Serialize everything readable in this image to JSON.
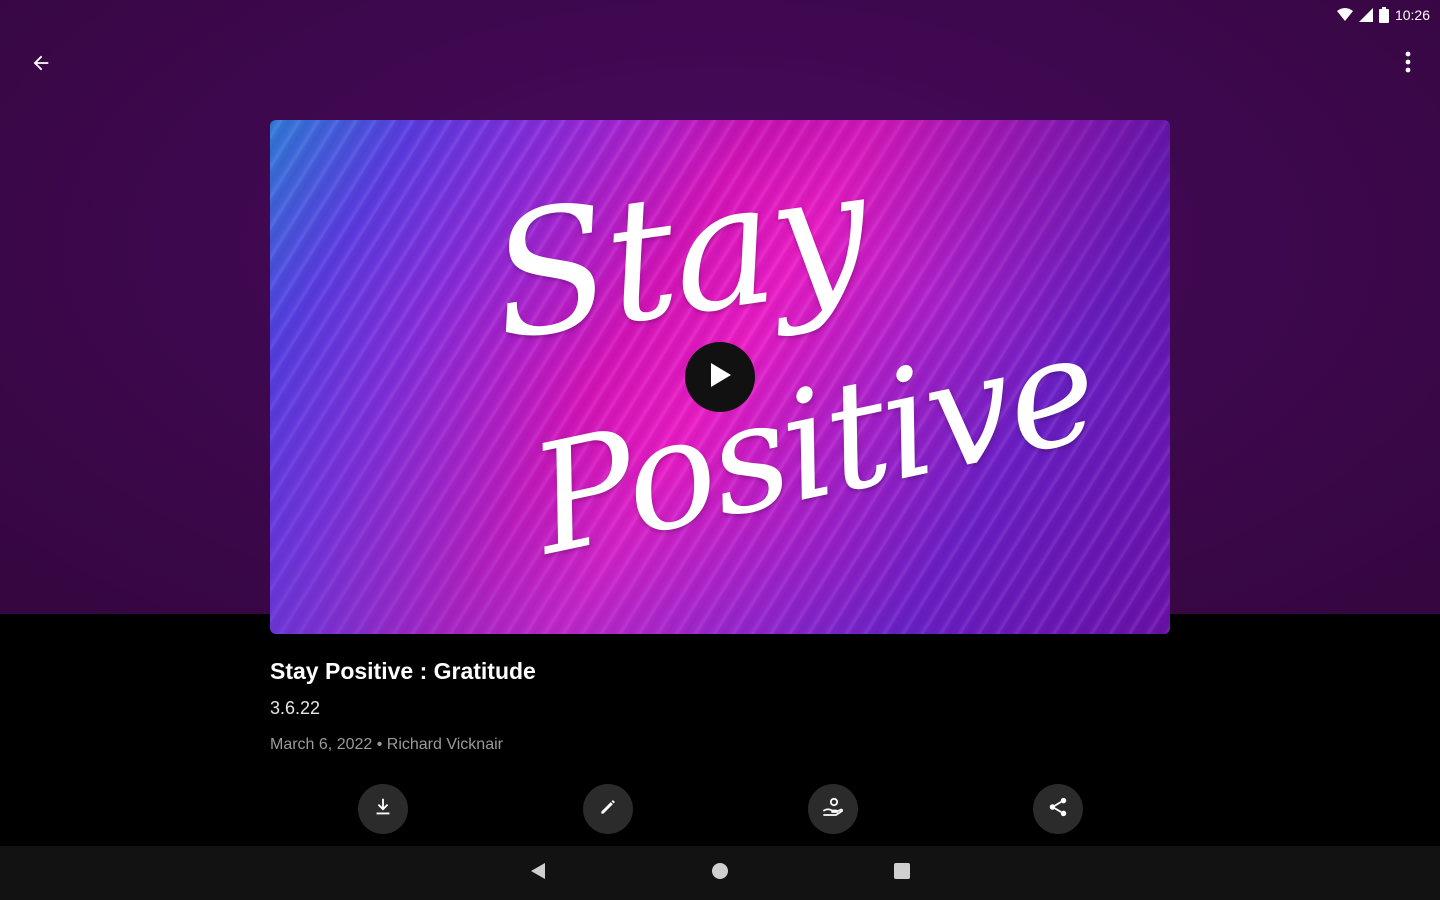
{
  "status_bar": {
    "time": "10:26",
    "icons": [
      "wifi-icon",
      "signal-icon",
      "battery-icon"
    ]
  },
  "toolbar": {
    "back_icon": "arrow-back-icon",
    "more_icon": "more-vert-icon"
  },
  "thumbnail": {
    "line1": "Stay",
    "line2": "Positive",
    "play_icon": "play-icon"
  },
  "media": {
    "title": "Stay Positive : Gratitude",
    "subtitle": "3.6.22",
    "meta": "March 6, 2022 • Richard Vicknair"
  },
  "actions": [
    {
      "icon": "download-icon"
    },
    {
      "icon": "edit-icon"
    },
    {
      "icon": "give-icon"
    },
    {
      "icon": "share-icon"
    }
  ],
  "nav": {
    "back": "nav-back-icon",
    "home": "nav-home-icon",
    "recents": "nav-recents-icon"
  },
  "colors": {
    "header_purple": "#3f0850",
    "background": "#000000",
    "button_gray": "#2b2b2b",
    "nav_bar": "#121212"
  }
}
